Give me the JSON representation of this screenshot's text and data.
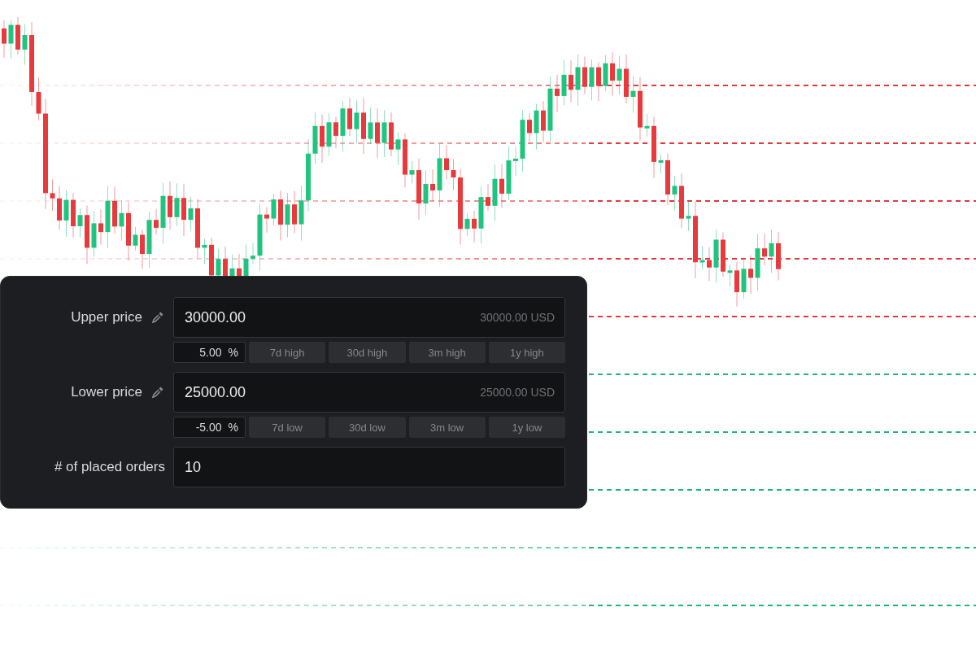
{
  "grid_levels": [
    {
      "color": "#e5383b"
    },
    {
      "color": "#e5383b"
    },
    {
      "color": "#e5383b"
    },
    {
      "color": "#e5383b"
    },
    {
      "color": "#e5383b"
    },
    {
      "color": "#1fb57a"
    },
    {
      "color": "#1fb57a"
    },
    {
      "color": "#1fb57a"
    },
    {
      "color": "#1fb57a"
    },
    {
      "color": "#1fb57a"
    }
  ],
  "settings": {
    "fields": [
      {
        "kind": "price",
        "label": "Upper price",
        "picker": true,
        "value": "30000.00",
        "converted": "30000.00 USD",
        "percent": "5.00",
        "percent_unit": "%",
        "presets": [
          "7d high",
          "30d high",
          "3m high",
          "1y high"
        ]
      },
      {
        "kind": "price",
        "label": "Lower price",
        "picker": true,
        "value": "25000.00",
        "converted": "25000.00 USD",
        "percent": "-5.00",
        "percent_unit": "%",
        "presets": [
          "7d low",
          "30d low",
          "3m low",
          "1y low"
        ]
      },
      {
        "kind": "count",
        "label": "# of placed orders",
        "picker": false,
        "value": "10"
      }
    ]
  }
}
